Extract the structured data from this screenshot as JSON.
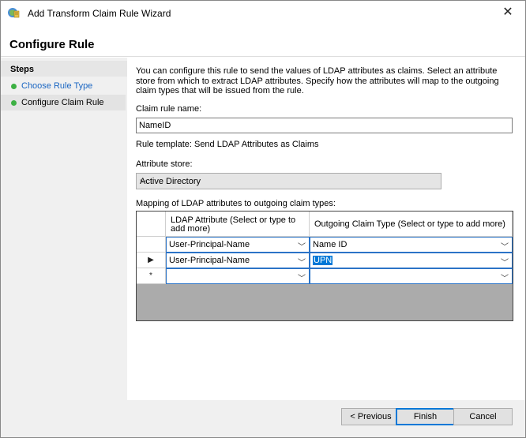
{
  "window": {
    "title": "Add Transform Claim Rule Wizard",
    "close_glyph": "✕"
  },
  "header": {
    "title": "Configure Rule"
  },
  "steps": {
    "title": "Steps",
    "items": [
      {
        "label": "Choose Rule Type",
        "state": "done-link"
      },
      {
        "label": "Configure Claim Rule",
        "state": "current"
      }
    ]
  },
  "main": {
    "description": "You can configure this rule to send the values of LDAP attributes as claims. Select an attribute store from which to extract LDAP attributes. Specify how the attributes will map to the outgoing claim types that will be issued from the rule.",
    "claim_rule_name_label": "Claim rule name:",
    "claim_rule_name_value": "NameID",
    "rule_template_text": "Rule template: Send LDAP Attributes as Claims",
    "attribute_store_label": "Attribute store:",
    "attribute_store_value": "Active Directory",
    "mapping_label": "Mapping of LDAP attributes to outgoing claim types:"
  },
  "mapping_grid": {
    "columns": [
      "LDAP Attribute (Select or type to add more)",
      "Outgoing Claim Type (Select or type to add more)"
    ],
    "rows": [
      {
        "indicator": "",
        "ldap": "User-Principal-Name",
        "claim": "Name ID",
        "claim_selected": false
      },
      {
        "indicator": "▶",
        "ldap": "User-Principal-Name",
        "claim": "UPN",
        "claim_selected": true
      },
      {
        "indicator": "*",
        "ldap": "",
        "claim": "",
        "claim_selected": false
      }
    ]
  },
  "footer": {
    "previous_label": "< Previous",
    "finish_label": "Finish",
    "cancel_label": "Cancel"
  },
  "icons": {
    "chevron": "﹀"
  },
  "colors": {
    "link": "#1a66c2",
    "step_dot": "#3cb043",
    "selection": "#0078d7"
  }
}
